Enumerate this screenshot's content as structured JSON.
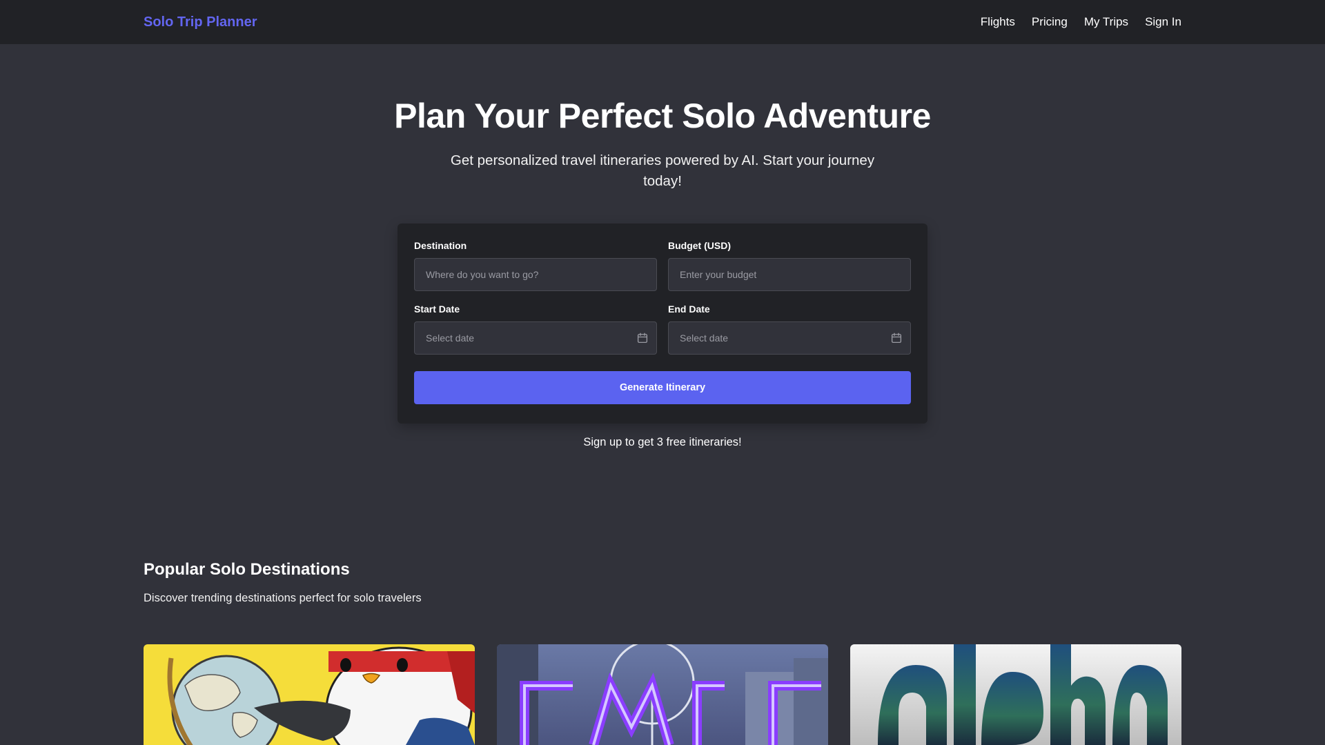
{
  "header": {
    "brand": "Solo Trip Planner",
    "nav": [
      "Flights",
      "Pricing",
      "My Trips",
      "Sign In"
    ]
  },
  "hero": {
    "title": "Plan Your Perfect Solo Adventure",
    "subtitle": "Get personalized travel itineraries powered by AI. Start your journey today!"
  },
  "form": {
    "destination": {
      "label": "Destination",
      "placeholder": "Where do you want to go?",
      "value": ""
    },
    "budget": {
      "label": "Budget (USD)",
      "placeholder": "Enter your budget",
      "value": ""
    },
    "start_date": {
      "label": "Start Date",
      "placeholder": "Select date",
      "value": "",
      "icon": "calendar-icon"
    },
    "end_date": {
      "label": "End Date",
      "placeholder": "Select date",
      "value": "",
      "icon": "calendar-icon"
    },
    "submit_label": "Generate Itinerary"
  },
  "signup_note": "Sign up to get 3 free itineraries!",
  "popular": {
    "title": "Popular Solo Destinations",
    "subtitle": "Discover trending destinations perfect for solo travelers",
    "cards": [
      {
        "image": "penguin-globe-illustration"
      },
      {
        "image": "ferris-wheel-city-letters"
      },
      {
        "image": "aloha-beach-letters"
      }
    ]
  },
  "colors": {
    "background": "#31323a",
    "header_bg": "#212226",
    "accent": "#5b63f0",
    "brand": "#6366f1"
  }
}
